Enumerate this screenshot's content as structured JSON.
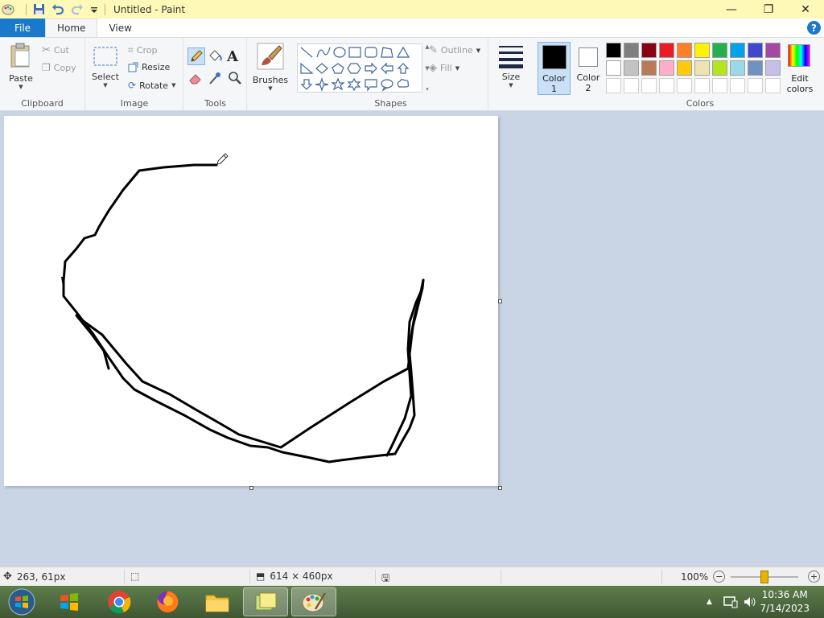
{
  "window": {
    "title": "Untitled - Paint",
    "minimize_glyph": "—",
    "maximize_glyph": "❐",
    "close_glyph": "✕"
  },
  "tabs": {
    "file": "File",
    "home": "Home",
    "view": "View",
    "help_glyph": "?"
  },
  "ribbon": {
    "clipboard": {
      "label": "Clipboard",
      "paste": "Paste",
      "cut": "Cut",
      "copy": "Copy"
    },
    "image": {
      "label": "Image",
      "select": "Select",
      "crop": "Crop",
      "resize": "Resize",
      "rotate": "Rotate"
    },
    "tools": {
      "label": "Tools",
      "text_glyph": "A"
    },
    "brushes": {
      "label": "Brushes"
    },
    "shapes": {
      "label": "Shapes",
      "outline": "Outline",
      "fill": "Fill"
    },
    "size": {
      "label": "Size"
    },
    "color1": {
      "line1": "Color",
      "line2": "1",
      "value": "#000000"
    },
    "color2": {
      "line1": "Color",
      "line2": "2",
      "value": "#ffffff"
    },
    "colors": {
      "label": "Colors",
      "row1": [
        "#000000",
        "#7f7f7f",
        "#880015",
        "#ed1c24",
        "#ff7f27",
        "#fff200",
        "#22b14c",
        "#00a2e8",
        "#3f48cc",
        "#a349a4"
      ],
      "row2": [
        "#ffffff",
        "#c3c3c3",
        "#b97a57",
        "#ffaec9",
        "#ffc90e",
        "#efe4b0",
        "#b5e61d",
        "#99d9ea",
        "#7092be",
        "#c8bfe7"
      ]
    },
    "edit_colors": {
      "line1": "Edit",
      "line2": "colors"
    }
  },
  "status": {
    "cursor_pos": "263, 61px",
    "canvas_size": "614 × 460px",
    "zoom": "100%",
    "zoom_fraction": 0.5
  },
  "taskbar": {
    "time": "10:36 AM",
    "date": "7/14/2023"
  }
}
